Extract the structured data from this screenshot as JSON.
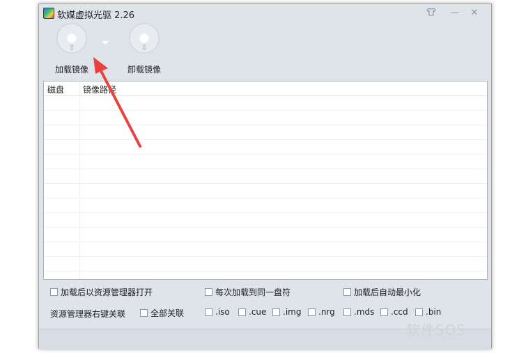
{
  "window": {
    "title": "软媒虚拟光驱 2.26",
    "controls": {
      "skin": "shirt-icon",
      "minimize": "—",
      "close": "✕"
    }
  },
  "toolbar": {
    "load_label": "加载镜像",
    "unload_label": "卸载镜像",
    "load_arrow": "⇧",
    "unload_arrow": "⇩"
  },
  "list": {
    "columns": [
      "磁盘",
      "镜像路径"
    ],
    "rows": []
  },
  "options": {
    "open_explorer": "加载后以资源管理器打开",
    "same_drive": "每次加载到同一盘符",
    "minimize_after": "加载后自动最小化",
    "context_menu_label": "资源管理器右键关联",
    "all_assoc": "全部关联",
    "extensions": [
      ".iso",
      ".cue",
      ".img",
      ".nrg",
      ".mds",
      ".ccd",
      ".bin"
    ]
  },
  "watermark": "软件SOS",
  "colors": {
    "annotation_arrow": "#e8433f",
    "window_bg": "#dfe4ea"
  }
}
